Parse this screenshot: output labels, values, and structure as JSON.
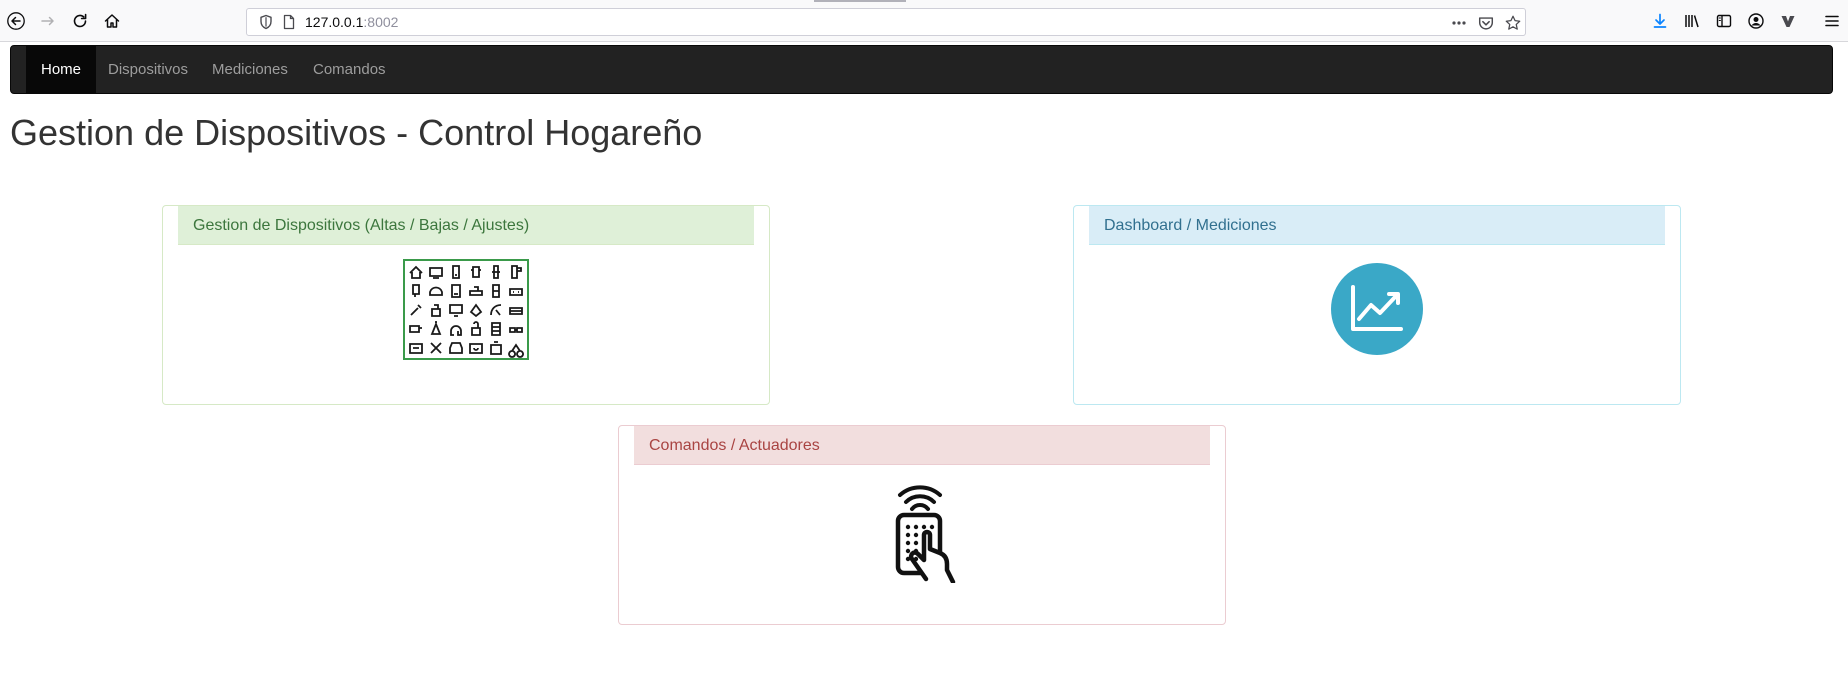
{
  "browser": {
    "url_host": "127.0.0.1",
    "url_port": ":8002",
    "accent": "#0a84ff"
  },
  "navbar": {
    "items": [
      {
        "label": "Home",
        "active": true
      },
      {
        "label": "Dispositivos",
        "active": false
      },
      {
        "label": "Mediciones",
        "active": false
      },
      {
        "label": "Comandos",
        "active": false
      }
    ]
  },
  "page": {
    "title": "Gestion de Dispositivos - Control Hogareño"
  },
  "panels": {
    "devices": {
      "heading": "Gestion de Dispositivos (Altas / Bajas / Ajustes)",
      "icon": "devices-grid-icon",
      "color": "#3c763d"
    },
    "dashboard": {
      "heading": "Dashboard / Mediciones",
      "icon": "trend-chart-icon",
      "color": "#31708f"
    },
    "commands": {
      "heading": "Comandos / Actuadores",
      "icon": "remote-control-icon",
      "color": "#a94442"
    }
  },
  "colors": {
    "navbar_bg": "#222222",
    "dashboard_circle": "#3aa8c7"
  }
}
